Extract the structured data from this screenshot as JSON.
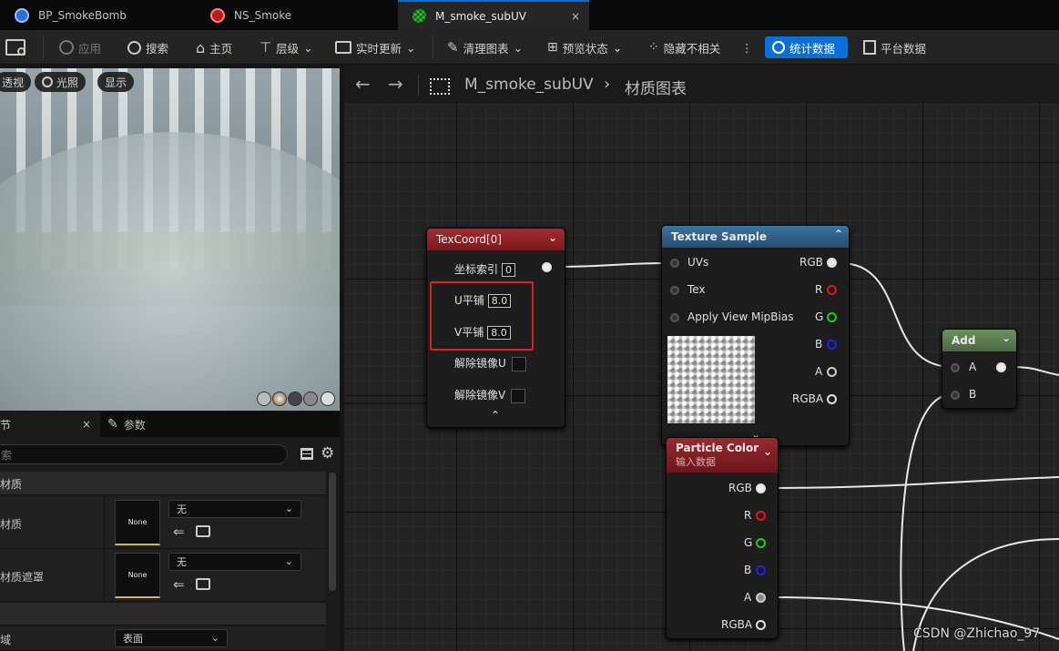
{
  "tabs": [
    {
      "label": "BP_SmokeBomb",
      "icon": "blueprint-icon"
    },
    {
      "label": "NS_Smoke",
      "icon": "niagara-icon"
    },
    {
      "label": "M_smoke_subUV",
      "icon": "material-icon",
      "active": true,
      "close": "×"
    }
  ],
  "toolbar": {
    "apply": "应用",
    "search": "搜索",
    "home": "主页",
    "hierarchy": "层级",
    "live_update": "实时更新",
    "clean_graph": "清理图表",
    "preview_state": "预览状态",
    "hide_unrelated": "隐藏不相关",
    "more": "⋮",
    "stats": "统计数据",
    "platform_stats": "平台数据"
  },
  "viewport": {
    "perspective": "透视",
    "lit": "光照",
    "show": "显示"
  },
  "details": {
    "tab_details": "节",
    "tab_close": "×",
    "tab_params": "参数",
    "search_placeholder": "索",
    "section_material": "材质",
    "row1_label": "材质",
    "row1_thumb": "None",
    "row1_value": "无",
    "row2_label": "材质遮罩",
    "row2_thumb": "None",
    "row2_value": "无",
    "row3_label": "域",
    "row3_value": "表面"
  },
  "graph": {
    "breadcrumb_asset": "M_smoke_subUV",
    "breadcrumb_sep": "›",
    "breadcrumb_graph": "材质图表",
    "watermark": "CSDN @Zhichao_97"
  },
  "nodes": {
    "texcoord": {
      "title": "TexCoord[0]",
      "coord_index_label": "坐标索引",
      "coord_index": "0",
      "u_tiling_label": "U平铺",
      "u_tiling": "8.0",
      "v_tiling_label": "V平铺",
      "v_tiling": "8.0",
      "unmirror_u": "解除镜像U",
      "unmirror_v": "解除镜像V"
    },
    "texture_sample": {
      "title": "Texture Sample",
      "in_uvs": "UVs",
      "in_tex": "Tex",
      "in_mipbias": "Apply View MipBias",
      "out_rgb": "RGB",
      "out_r": "R",
      "out_g": "G",
      "out_b": "B",
      "out_a": "A",
      "out_rgba": "RGBA"
    },
    "add": {
      "title": "Add",
      "in_a": "A",
      "in_b": "B"
    },
    "particle_color": {
      "title": "Particle Color",
      "subtitle": "输入数据",
      "out_rgb": "RGB",
      "out_r": "R",
      "out_g": "G",
      "out_b": "B",
      "out_a": "A",
      "out_rgba": "RGBA"
    }
  },
  "colors": {
    "accent_blue": "#0a70d8",
    "texcoord_header": "#8e1f24",
    "texture_header": "#2c5f86",
    "add_header": "#56764a",
    "particle_header": "#7a1e24",
    "highlight_box": "#e02020"
  }
}
